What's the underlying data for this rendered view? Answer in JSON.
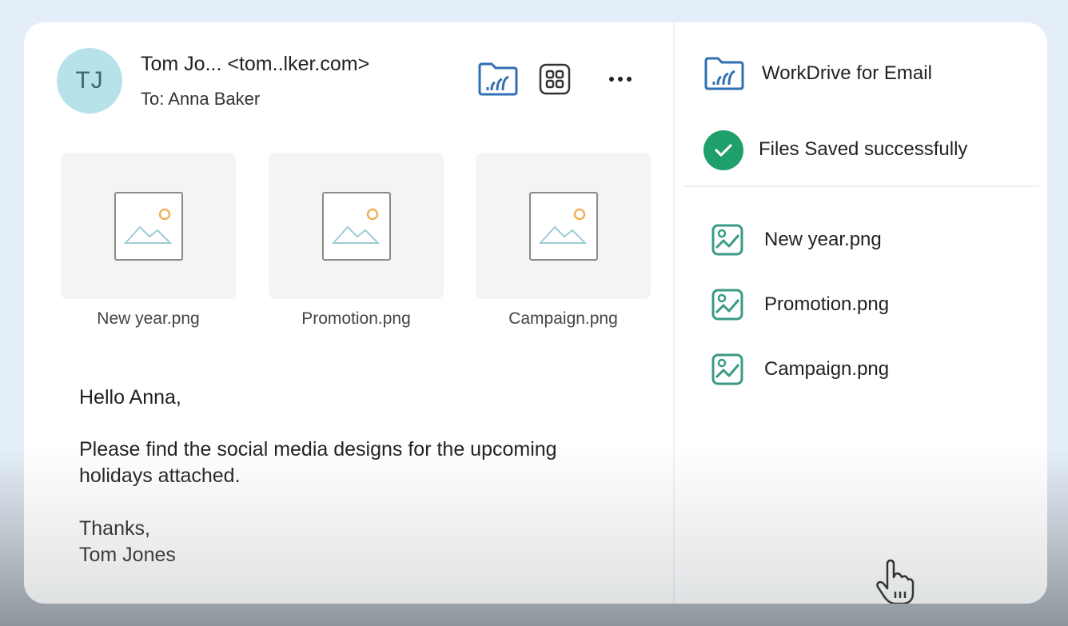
{
  "email": {
    "avatar_initials": "TJ",
    "sender": "Tom Jo... <tom..lker.com>",
    "recipient": "To: Anna Baker",
    "toolbar": {
      "workdrive_icon": "workdrive-folder-icon",
      "apps_icon": "grid-icon",
      "more_icon": "more-icon"
    },
    "attachments": [
      {
        "name": "New year.png"
      },
      {
        "name": "Promotion.png"
      },
      {
        "name": "Campaign.png"
      }
    ],
    "body": {
      "greeting": "Hello Anna,",
      "message_line1": "Please find the social media designs for the upcoming",
      "message_line2": "holidays attached.",
      "signoff": "Thanks,",
      "signature": "Tom Jones"
    }
  },
  "panel": {
    "title": "WorkDrive for Email",
    "status": "Files Saved successfully",
    "files": [
      {
        "name": "New year.png"
      },
      {
        "name": "Promotion.png"
      },
      {
        "name": "Campaign.png"
      }
    ]
  },
  "colors": {
    "accent_blue": "#2f6fb3",
    "success_green": "#1fa06a",
    "file_icon_teal": "#3a9a86",
    "avatar_bg": "#b8e2ea"
  }
}
